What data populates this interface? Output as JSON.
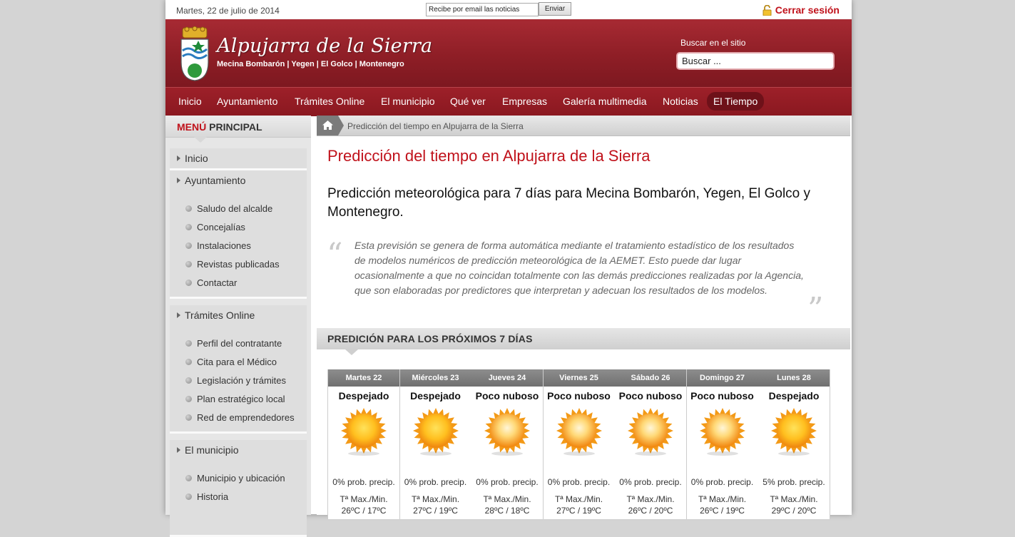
{
  "topbar": {
    "date": "Martes, 22 de julio de 2014",
    "newsletter_placeholder": "Recibe por email las noticias",
    "newsletter_button": "Enviar",
    "logout": "Cerrar sesión"
  },
  "header": {
    "title": "Alpujarra de la Sierra",
    "subtitle": "Mecina Bombarón | Yegen | El Golco | Montenegro",
    "search_label": "Buscar en el sitio",
    "search_placeholder": "Buscar ..."
  },
  "nav": [
    "Inicio",
    "Ayuntamiento",
    "Trámites Online",
    "El municipio",
    "Qué ver",
    "Empresas",
    "Galería multimedia",
    "Noticias",
    "El Tiempo"
  ],
  "nav_active": "El Tiempo",
  "sidebar": {
    "menu_title_red": "MENÚ",
    "menu_title_rest": " PRINCIPAL",
    "sections": [
      {
        "label": "Inicio",
        "items": []
      },
      {
        "label": "Ayuntamiento",
        "items": [
          "Saludo del alcalde",
          "Concejalías",
          "Instalaciones",
          "Revistas publicadas",
          "Contactar"
        ]
      },
      {
        "label": "Trámites Online",
        "items": [
          "Perfil del contratante",
          "Cita para el Médico",
          "Legislación y trámites",
          "Plan estratégico local",
          "Red de emprendedores"
        ]
      },
      {
        "label": "El municipio",
        "items": [
          "Municipio y ubicación",
          "Historia"
        ]
      }
    ]
  },
  "main": {
    "breadcrumb": "Predicción del tiempo en Alpujarra de la Sierra",
    "title": "Predicción del tiempo en Alpujarra de la Sierra",
    "subtitle": "Predicción meteorológica para 7 días para Mecina Bombarón, Yegen, El Golco y Montenegro.",
    "quote": "Esta previsión se genera de forma automática mediante el tratamiento estadístico de los resultados de modelos numéricos de predicción meteorológica de la AEMET. Esto puede dar lugar ocasionalmente a que no coincidan totalmente con las demás predicciones realizadas por la Agencia, que son elaboradas por predictores que interpretan y adecuan los resultados de los modelos.",
    "forecast_title": "PREDICIÓN PARA LOS PRÓXIMOS 7 DÍAS",
    "temp_label": "Tª Max./Min.",
    "days": [
      {
        "day": "Martes 22",
        "state": "Despejado",
        "icon": "sun-clear-icon",
        "precip": "0% prob. precip.",
        "temp": "26ºC / 17ºC"
      },
      {
        "day": "Miércoles 23",
        "state": "Despejado",
        "icon": "sun-clear-icon",
        "precip": "0% prob. precip.",
        "temp": "27ºC / 19ºC"
      },
      {
        "day": "Jueves 24",
        "state": "Poco nuboso",
        "icon": "sun-hazy-icon",
        "precip": "0% prob. precip.",
        "temp": "28ºC / 18ºC"
      },
      {
        "day": "Viernes 25",
        "state": "Poco nuboso",
        "icon": "sun-hazy-icon",
        "precip": "0% prob. precip.",
        "temp": "27ºC / 19ºC"
      },
      {
        "day": "Sábado 26",
        "state": "Poco nuboso",
        "icon": "sun-hazy-icon",
        "precip": "0% prob. precip.",
        "temp": "26ºC / 20ºC"
      },
      {
        "day": "Domingo 27",
        "state": "Poco nuboso",
        "icon": "sun-hazy-icon",
        "precip": "0% prob. precip.",
        "temp": "26ºC / 19ºC"
      },
      {
        "day": "Lunes 28",
        "state": "Despejado",
        "icon": "sun-clear-icon",
        "precip": "5% prob. precip.",
        "temp": "29ºC / 20ºC"
      }
    ]
  },
  "colors": {
    "brand_red": "#8e1e26",
    "accent_red": "#c0121b",
    "sun_orange": "#f7a21b"
  }
}
